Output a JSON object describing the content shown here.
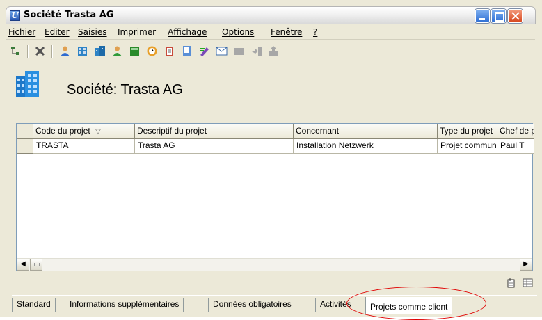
{
  "window": {
    "title": "Société Trasta AG",
    "app_icon_letter": "U"
  },
  "menu": {
    "items": [
      {
        "label": "Fichier"
      },
      {
        "label": "Editer"
      },
      {
        "label": "Saisies"
      },
      {
        "label": "Imprimer"
      },
      {
        "label": "Affichage"
      },
      {
        "label": "Options"
      },
      {
        "label": "Fenêtre"
      },
      {
        "label": "?"
      }
    ]
  },
  "toolbar": {
    "icons": [
      "tree-icon",
      "delete-icon",
      "person-icon",
      "building-icon",
      "building-group-icon",
      "person-green-icon",
      "book-icon",
      "clock-icon",
      "notebook-icon",
      "document-icon",
      "pen-icon",
      "envelope-icon",
      "disabled-box-icon",
      "disabled-arrow-icon",
      "disabled-export-icon"
    ]
  },
  "header": {
    "title": "Société: Trasta AG"
  },
  "grid": {
    "columns": [
      {
        "label": "Code du projet"
      },
      {
        "label": "Descriptif du projet"
      },
      {
        "label": "Concernant"
      },
      {
        "label": "Type du projet"
      },
      {
        "label": "Chef de projet"
      }
    ],
    "rows": [
      [
        "TRASTA",
        "Trasta AG",
        "Installation Netzwerk",
        "Projet commun",
        "Paul T"
      ]
    ],
    "sort_indicator": "▽"
  },
  "tabs": [
    {
      "label": "Standard",
      "active": false
    },
    {
      "label": "Informations supplémentaires",
      "active": false
    },
    {
      "label": "Données obligatoires",
      "active": false
    },
    {
      "label": "Activités",
      "active": false
    },
    {
      "label": "Projets comme client",
      "active": true
    }
  ],
  "colors": {
    "highlight_circle": "#e00000",
    "window_bg": "#ece9d8",
    "title_close": "#d6451c"
  }
}
